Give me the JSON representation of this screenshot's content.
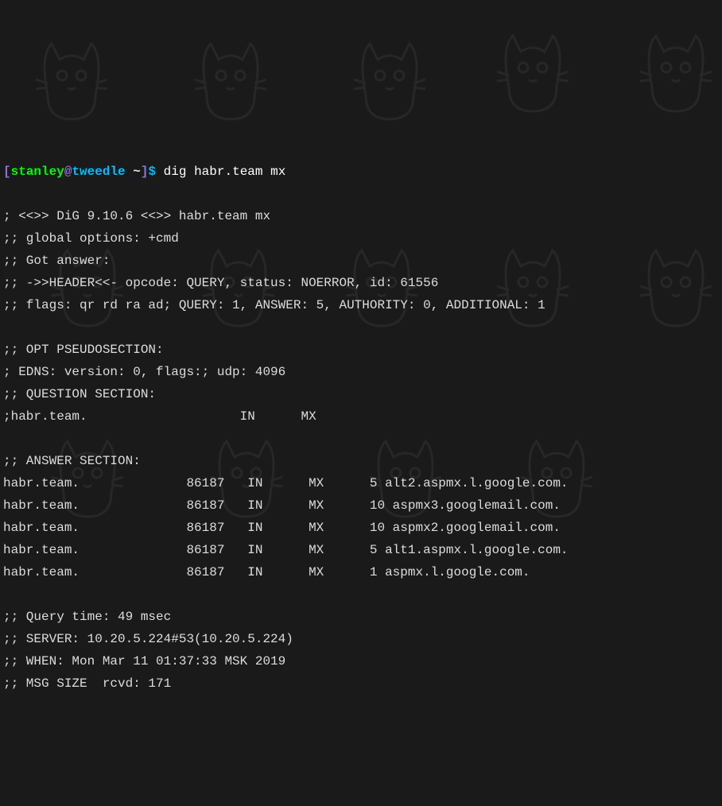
{
  "prompt": {
    "open_bracket": "[",
    "user": "stanley",
    "at": "@",
    "host": "tweedle",
    "path": " ~",
    "close_bracket": "]",
    "dollar": "$ "
  },
  "command": "dig habr.team mx",
  "output": {
    "blank0": " ",
    "version": "; <<>> DiG 9.10.6 <<>> habr.team mx",
    "global_opts": ";; global options: +cmd",
    "got_answer": ";; Got answer:",
    "header": ";; ->>HEADER<<- opcode: QUERY, status: NOERROR, id: 61556",
    "flags": ";; flags: qr rd ra ad; QUERY: 1, ANSWER: 5, AUTHORITY: 0, ADDITIONAL: 1",
    "blank1": " ",
    "opt_section": ";; OPT PSEUDOSECTION:",
    "edns": "; EDNS: version: 0, flags:; udp: 4096",
    "question_hdr": ";; QUESTION SECTION:",
    "question": ";habr.team.                    IN      MX",
    "blank2": " ",
    "answer_hdr": ";; ANSWER SECTION:",
    "answers": [
      "habr.team.              86187   IN      MX      5 alt2.aspmx.l.google.com.",
      "habr.team.              86187   IN      MX      10 aspmx3.googlemail.com.",
      "habr.team.              86187   IN      MX      10 aspmx2.googlemail.com.",
      "habr.team.              86187   IN      MX      5 alt1.aspmx.l.google.com.",
      "habr.team.              86187   IN      MX      1 aspmx.l.google.com."
    ],
    "blank3": " ",
    "query_time": ";; Query time: 49 msec",
    "server": ";; SERVER: 10.20.5.224#53(10.20.5.224)",
    "when": ";; WHEN: Mon Mar 11 01:37:33 MSK 2019",
    "msg_size": ";; MSG SIZE  rcvd: 171"
  }
}
